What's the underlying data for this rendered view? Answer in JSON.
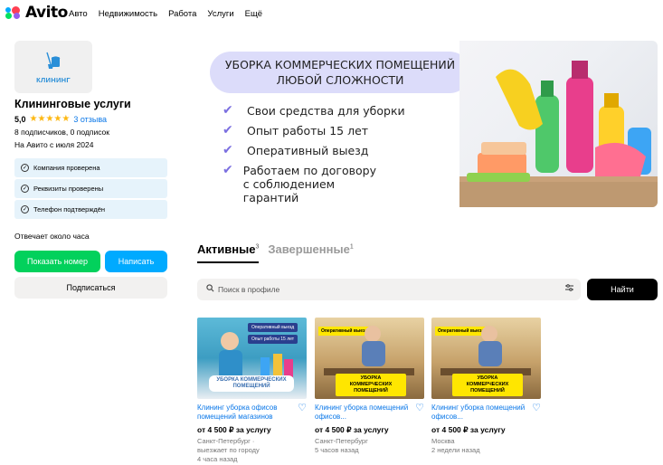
{
  "header": {
    "logo_text": "Avito",
    "nav": [
      "Авто",
      "Недвижимость",
      "Работа",
      "Услуги",
      "Ещё"
    ]
  },
  "profile": {
    "logo_label": "КЛИНИНГ",
    "name": "Клининговые услуги",
    "rating": "5,0",
    "stars": "★★★★★",
    "reviews": "3 отзыва",
    "subscribers": "8 подписчиков, 0 подписок",
    "since": "На Авито с июля 2024",
    "checks": [
      "Компания проверена",
      "Реквизиты проверены",
      "Телефон подтверждён"
    ],
    "answer_time": "Отвечает около часа",
    "show_phone": "Показать номер",
    "write": "Написать",
    "subscribe": "Подписаться"
  },
  "banner": {
    "headline_1": "УБОРКА КОММЕРЧЕСКИХ ПОМЕЩЕНИЙ",
    "headline_2": "ЛЮБОЙ СЛОЖНОСТИ",
    "items": [
      "Свои средства для уборки",
      "Опыт работы 15 лет",
      "Оперативный выезд",
      "Работаем по договору с соблюдением гарантий"
    ]
  },
  "tabs": [
    {
      "label": "Активные",
      "count": "3"
    },
    {
      "label": "Завершенные",
      "count": "1"
    }
  ],
  "search": {
    "placeholder": "Поиск в профиле",
    "button": "Найти"
  },
  "listings": [
    {
      "title": "Клининг уборка офисов помещений магазинов",
      "price": "от 4 500 ₽ за услугу",
      "location": "Санкт-Петербург ·",
      "extra": "выезжает по городу",
      "time": "4 часа назад",
      "badge_1": "Оперативный выезд",
      "badge_2": "Опыт работы 15 лет",
      "overlay": "УБОРКА КОММЕРЧЕСКИХ ПОМЕЩЕНИЙ"
    },
    {
      "title": "Клининг уборка помещений офисов...",
      "price": "от 4 500 ₽ за услугу",
      "location": "Санкт-Петербург",
      "extra": "",
      "time": "5 часов назад",
      "badge_1": "Оперативный выезд",
      "overlay": "УБОРКА КОММЕРЧЕСКИХ ПОМЕЩЕНИЙ"
    },
    {
      "title": "Клининг уборка помещений офисов...",
      "price": "от 4 500 ₽ за услугу",
      "location": "Москва",
      "extra": "",
      "time": "2 недели назад",
      "badge_1": "Оперативный выезд",
      "overlay": "УБОРКА КОММЕРЧЕСКИХ ПОМЕЩЕНИЙ"
    }
  ],
  "colors": {
    "green": "#02d15c",
    "blue": "#00aaff",
    "link": "#0a77e8",
    "star": "#fdb813",
    "check_bg": "#e6f3fb",
    "pill": "#dcdcfa"
  }
}
